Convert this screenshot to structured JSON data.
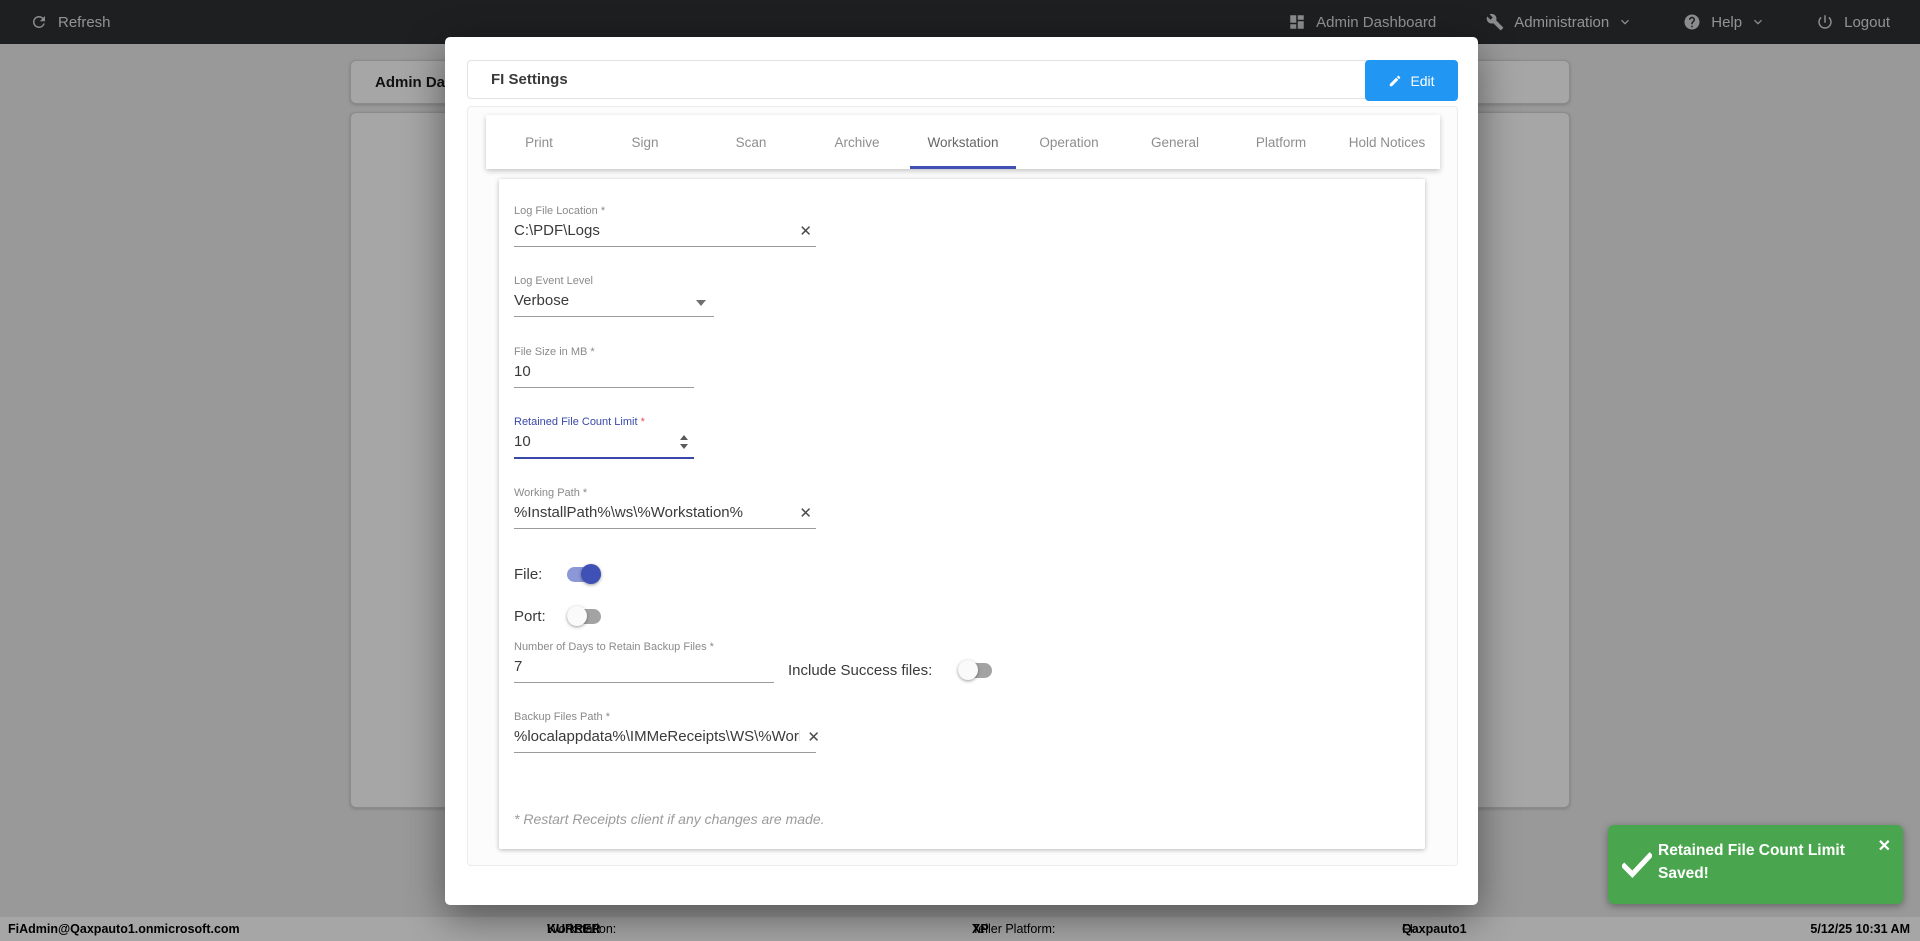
{
  "top_bar": {
    "refresh": "Refresh",
    "admin_dashboard": "Admin Dashboard",
    "administration": "Administration",
    "help": "Help",
    "logout": "Logout"
  },
  "background_page": {
    "title": "Admin Dashboard"
  },
  "modal": {
    "title": "FI Settings",
    "edit_label": "Edit",
    "tabs": [
      {
        "label": "Print",
        "active": false
      },
      {
        "label": "Sign",
        "active": false
      },
      {
        "label": "Scan",
        "active": false
      },
      {
        "label": "Archive",
        "active": false
      },
      {
        "label": "Workstation",
        "active": true
      },
      {
        "label": "Operation",
        "active": false
      },
      {
        "label": "General",
        "active": false
      },
      {
        "label": "Platform",
        "active": false
      },
      {
        "label": "Hold Notices",
        "active": false
      }
    ],
    "form": {
      "log_file_location": {
        "label": "Log File Location *",
        "value": "C:\\PDF\\Logs"
      },
      "log_event_level": {
        "label": "Log Event Level",
        "value": "Verbose"
      },
      "file_size_mb": {
        "label": "File Size in MB *",
        "value": "10"
      },
      "retained_file_count": {
        "label": "Retained File Count Limit",
        "required_mark": "*",
        "value": "10",
        "focused": true
      },
      "working_path": {
        "label": "Working Path *",
        "value": "%InstallPath%\\ws\\%Workstation%"
      },
      "file_toggle": {
        "label": "File:",
        "on": true
      },
      "port_toggle": {
        "label": "Port:",
        "on": false
      },
      "days_to_retain": {
        "label": "Number of Days to Retain Backup Files *",
        "value": "7"
      },
      "include_success": {
        "label": "Include Success files:",
        "on": false
      },
      "backup_files_path": {
        "label": "Backup Files Path *",
        "value": "%localappdata%\\IMMeReceipts\\WS\\%Works"
      },
      "note": "* Restart Receipts client if any changes are made."
    }
  },
  "toast": {
    "line1": "Retained File Count Limit",
    "line2": "Saved!",
    "close_glyph": "✕"
  },
  "status_bar": {
    "user": "FiAdmin@Qaxpauto1.onmicrosoft.com",
    "workstation_label": "Workstation: ",
    "workstation_value": "KURRER",
    "platform_label": "Teller Platform: ",
    "platform_value": "XP",
    "fi_label": "FI: ",
    "fi_value": "Qaxpauto1",
    "datetime": "5/12/25 10:31 AM"
  },
  "icons": {
    "refresh": "refresh-circular-arrow",
    "admin_dashboard": "dashboard-grid",
    "administration": "wrench",
    "help": "question-circle",
    "logout": "power",
    "caret": "chevron-down",
    "edit": "pencil",
    "clear": "x",
    "select": "triangle-down",
    "number_spinner": "up-down-triangles",
    "toast_status": "checkmark",
    "toast_close": "x"
  },
  "colors": {
    "accent_indigo": "#3f51b5",
    "focused_label_blue": "#3949ab",
    "edit_button_blue": "#2196f3",
    "toast_green": "#4aa64e",
    "topbar_bg": "#1e1f21",
    "required_red": "#e8505b"
  }
}
